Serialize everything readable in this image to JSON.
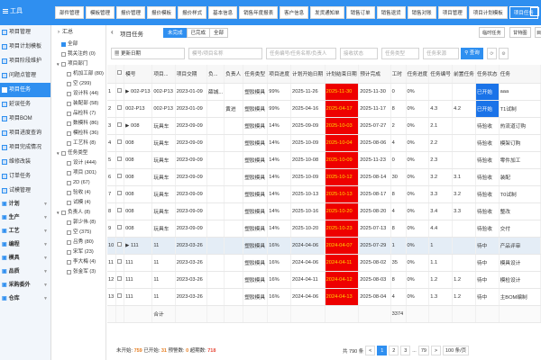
{
  "app": {
    "menu_label": "工具"
  },
  "top_tabs": [
    "部件管理",
    "模板管理",
    "报价管理",
    "报价模板",
    "报价样式",
    "基本信息",
    "销售年度报表",
    "客户信息",
    "发货通知单",
    "销售订单",
    "销售退货",
    "销售对账",
    "项目管理",
    "项目计划模板",
    "项目任务"
  ],
  "nav": {
    "items": [
      {
        "label": "项目管理"
      },
      {
        "label": "项目计划模板"
      },
      {
        "label": "项目阶段维护"
      },
      {
        "label": "问题点管理"
      },
      {
        "label": "项目任务"
      },
      {
        "label": "延误任务"
      },
      {
        "label": "项目BOM"
      },
      {
        "label": "项目进度查询"
      },
      {
        "label": "项目完成情况"
      },
      {
        "label": "维修改装"
      },
      {
        "label": "订单任务"
      },
      {
        "label": "试模管理"
      }
    ],
    "groups": [
      {
        "label": "计划"
      },
      {
        "label": "生产"
      },
      {
        "label": "工艺"
      },
      {
        "label": "编程"
      },
      {
        "label": "模具"
      },
      {
        "label": "品质"
      },
      {
        "label": "采购委外"
      },
      {
        "label": "仓库"
      }
    ]
  },
  "tree": {
    "header": "汇总",
    "nodes": [
      {
        "label": "全部",
        "lvl": 0,
        "caret": ""
      },
      {
        "label": "我关注的 (0)",
        "lvl": 0,
        "caret": ""
      },
      {
        "label": "项目部门",
        "lvl": 0,
        "caret": "▼"
      },
      {
        "label": "机加工部 (80)",
        "lvl": 1,
        "caret": ""
      },
      {
        "label": "空 (299)",
        "lvl": 1,
        "caret": ""
      },
      {
        "label": "设计科 (44)",
        "lvl": 1,
        "caret": ""
      },
      {
        "label": "装配部 (58)",
        "lvl": 1,
        "caret": ""
      },
      {
        "label": "品检科 (7)",
        "lvl": 1,
        "caret": ""
      },
      {
        "label": "数模科 (86)",
        "lvl": 1,
        "caret": ""
      },
      {
        "label": "模检科 (36)",
        "lvl": 1,
        "caret": ""
      },
      {
        "label": "工艺科 (8)",
        "lvl": 1,
        "caret": ""
      },
      {
        "label": "任务类型",
        "lvl": 0,
        "caret": "▼"
      },
      {
        "label": "设计 (444)",
        "lvl": 1,
        "caret": ""
      },
      {
        "label": "项目 (301)",
        "lvl": 1,
        "caret": ""
      },
      {
        "label": "2D (67)",
        "lvl": 1,
        "caret": ""
      },
      {
        "label": "验收 (4)",
        "lvl": 1,
        "caret": ""
      },
      {
        "label": "试模 (4)",
        "lvl": 1,
        "caret": ""
      },
      {
        "label": "负责人 (8)",
        "lvl": 0,
        "caret": "▼"
      },
      {
        "label": "郭少伟 (8)",
        "lvl": 1,
        "caret": ""
      },
      {
        "label": "空 (375)",
        "lvl": 1,
        "caret": ""
      },
      {
        "label": "吕秀 (80)",
        "lvl": 1,
        "caret": ""
      },
      {
        "label": "宋军 (23)",
        "lvl": 1,
        "caret": ""
      },
      {
        "label": "李大梅 (4)",
        "lvl": 1,
        "caret": ""
      },
      {
        "label": "张金军 (3)",
        "lvl": 1,
        "caret": ""
      }
    ]
  },
  "toolbar": {
    "title": "项目任务",
    "segments": [
      "未完成",
      "已完成",
      "全部"
    ],
    "right_buttons": [
      "临时任务",
      "甘特图",
      "目"
    ],
    "filters": {
      "date": "更新日期",
      "code": "模号/项目名称",
      "task": "任务编号/任务名称/负责人",
      "status": "接收状态",
      "type": "任务类型",
      "source": "任务来源"
    },
    "search_label": "查询"
  },
  "table": {
    "headers": [
      "",
      "",
      "模号",
      "项目...",
      "项目交期",
      "负...",
      "负责人",
      "任务类型",
      "项目进度",
      "计划开始日期",
      "计划结束日期",
      "预计完成",
      "工时",
      "任务进度",
      "任务编号",
      "前置任务",
      "任务状态",
      "任务"
    ],
    "rows": [
      {
        "no": "1",
        "code": "002-P13",
        "tree": "▶",
        "proj": "002-P13",
        "due": "2023-01-09",
        "mgr": "薛城...",
        "owner": "",
        "type": "塑胶模具",
        "prog": "99%",
        "start": "2025-11-26",
        "end": "2025-11-30",
        "pred": "2025-11-30",
        "hrs": "0",
        "tprog": "0%",
        "tno": "",
        "pre": "",
        "status": "已开始",
        "status_blue": true,
        "task": "aaa"
      },
      {
        "no": "2",
        "code": "002-P13",
        "tree": "",
        "proj": "002-P13",
        "due": "2023-01-09",
        "mgr": "",
        "owner": "黄进",
        "type": "塑胶模具",
        "prog": "99%",
        "start": "2025-04-16",
        "end": "2025-04-17",
        "pred": "2025-11-17",
        "hrs": "8",
        "tprog": "0%",
        "tno": "4.3",
        "pre": "4.2",
        "status": "已开始",
        "status_blue": true,
        "task": "T1试制"
      },
      {
        "no": "3",
        "code": "008",
        "tree": "▶",
        "proj": "玩具车",
        "due": "2023-09-09",
        "mgr": "",
        "owner": "",
        "type": "塑胶模具",
        "prog": "14%",
        "start": "2025-09-09",
        "end": "2025-10-03",
        "pred": "2025-07-27",
        "hrs": "2",
        "tprog": "0%",
        "tno": "2.1",
        "pre": "",
        "status": "待验收",
        "status_blue": false,
        "task": "热流道订购"
      },
      {
        "no": "4",
        "code": "008",
        "tree": "",
        "proj": "玩具车",
        "due": "2023-09-09",
        "mgr": "",
        "owner": "",
        "type": "塑胶模具",
        "prog": "14%",
        "start": "2025-10-09",
        "end": "2025-10-04",
        "pred": "2025-08-06",
        "hrs": "4",
        "tprog": "0%",
        "tno": "2.2",
        "pre": "",
        "status": "待验收",
        "status_blue": false,
        "task": "模架订购"
      },
      {
        "no": "5",
        "code": "008",
        "tree": "",
        "proj": "玩具车",
        "due": "2023-09-09",
        "mgr": "",
        "owner": "",
        "type": "塑胶模具",
        "prog": "14%",
        "start": "2025-10-08",
        "end": "2025-10-09",
        "pred": "2025-11-23",
        "hrs": "0",
        "tprog": "0%",
        "tno": "2.3",
        "pre": "",
        "status": "待验收",
        "status_blue": false,
        "task": "零件加工"
      },
      {
        "no": "6",
        "code": "008",
        "tree": "",
        "proj": "玩具车",
        "due": "2023-09-09",
        "mgr": "",
        "owner": "",
        "type": "塑胶模具",
        "prog": "14%",
        "start": "2025-10-09",
        "end": "2025-10-12",
        "pred": "2025-08-14",
        "hrs": "30",
        "tprog": "0%",
        "tno": "3.2",
        "pre": "3.1",
        "status": "待验收",
        "status_blue": false,
        "task": "装配"
      },
      {
        "no": "7",
        "code": "008",
        "tree": "",
        "proj": "玩具车",
        "due": "2023-09-09",
        "mgr": "",
        "owner": "",
        "type": "塑胶模具",
        "prog": "14%",
        "start": "2025-10-13",
        "end": "2025-10-13",
        "pred": "2025-08-17",
        "hrs": "8",
        "tprog": "0%",
        "tno": "3.3",
        "pre": "3.2",
        "status": "待验收",
        "status_blue": false,
        "task": "T0试制"
      },
      {
        "no": "8",
        "code": "008",
        "tree": "",
        "proj": "玩具车",
        "due": "2023-09-09",
        "mgr": "",
        "owner": "",
        "type": "塑胶模具",
        "prog": "14%",
        "start": "2025-10-16",
        "end": "2025-10-20",
        "pred": "2025-08-20",
        "hrs": "4",
        "tprog": "0%",
        "tno": "3.4",
        "pre": "3.3",
        "status": "待验收",
        "status_blue": false,
        "task": "整改"
      },
      {
        "no": "9",
        "code": "008",
        "tree": "",
        "proj": "玩具车",
        "due": "2023-09-09",
        "mgr": "",
        "owner": "",
        "type": "塑胶模具",
        "prog": "14%",
        "start": "2025-10-20",
        "end": "2025-10-23",
        "pred": "2025-07-13",
        "hrs": "8",
        "tprog": "0%",
        "tno": "4.4",
        "pre": "",
        "status": "待验收",
        "status_blue": false,
        "task": "交付"
      },
      {
        "no": "10",
        "code": "111",
        "tree": "▶",
        "proj": "11",
        "due": "2023-03-26",
        "mgr": "",
        "owner": "",
        "type": "塑胶模具",
        "prog": "16%",
        "start": "2024-04-06",
        "end": "2024-04-07",
        "pred": "2025-07-29",
        "hrs": "1",
        "tprog": "0%",
        "tno": "1",
        "pre": "",
        "status": "待中",
        "status_blue": false,
        "task": "产品评审"
      },
      {
        "no": "11",
        "code": "111",
        "tree": "",
        "proj": "11",
        "due": "2023-03-26",
        "mgr": "",
        "owner": "",
        "type": "塑胶模具",
        "prog": "16%",
        "start": "2024-04-06",
        "end": "2024-04-11",
        "pred": "2025-08-02",
        "hrs": "35",
        "tprog": "0%",
        "tno": "1.1",
        "pre": "",
        "status": "待中",
        "status_blue": false,
        "task": "模具设计"
      },
      {
        "no": "12",
        "code": "111",
        "tree": "",
        "proj": "11",
        "due": "2023-03-26",
        "mgr": "",
        "owner": "",
        "type": "塑胶模具",
        "prog": "16%",
        "start": "2024-04-11",
        "end": "2024-04-12",
        "pred": "2025-08-03",
        "hrs": "8",
        "tprog": "0%",
        "tno": "1.2",
        "pre": "1.2",
        "status": "待中",
        "status_blue": false,
        "task": "模检设计"
      },
      {
        "no": "13",
        "code": "111",
        "tree": "",
        "proj": "11",
        "due": "2023-03-26",
        "mgr": "",
        "owner": "",
        "type": "塑胶模具",
        "prog": "16%",
        "start": "2024-04-06",
        "end": "2024-04-13",
        "pred": "2025-08-04",
        "hrs": "4",
        "tprog": "0%",
        "tno": "1.3",
        "pre": "1.2",
        "status": "待中",
        "status_blue": false,
        "task": "主BOM编制"
      }
    ],
    "footer": {
      "label": "合计",
      "hours": "3374"
    }
  },
  "status": {
    "not_started_label": "未开始:",
    "not_started": "759",
    "started_label": "已开始:",
    "started": "31",
    "overdue_label": "预警数:",
    "overdue": "0",
    "delayed_label": "超期数:",
    "delayed": "718"
  },
  "pager": {
    "total": "共 790 条",
    "prev": "<",
    "pages": [
      "1",
      "2",
      "3"
    ],
    "ellipsis": "...",
    "last": "79",
    "next": ">",
    "size": "100 条/页"
  },
  "colors": {
    "primary": "#2f8ff0",
    "overdue": "#ee0000",
    "status_started": "#1a73e8"
  }
}
